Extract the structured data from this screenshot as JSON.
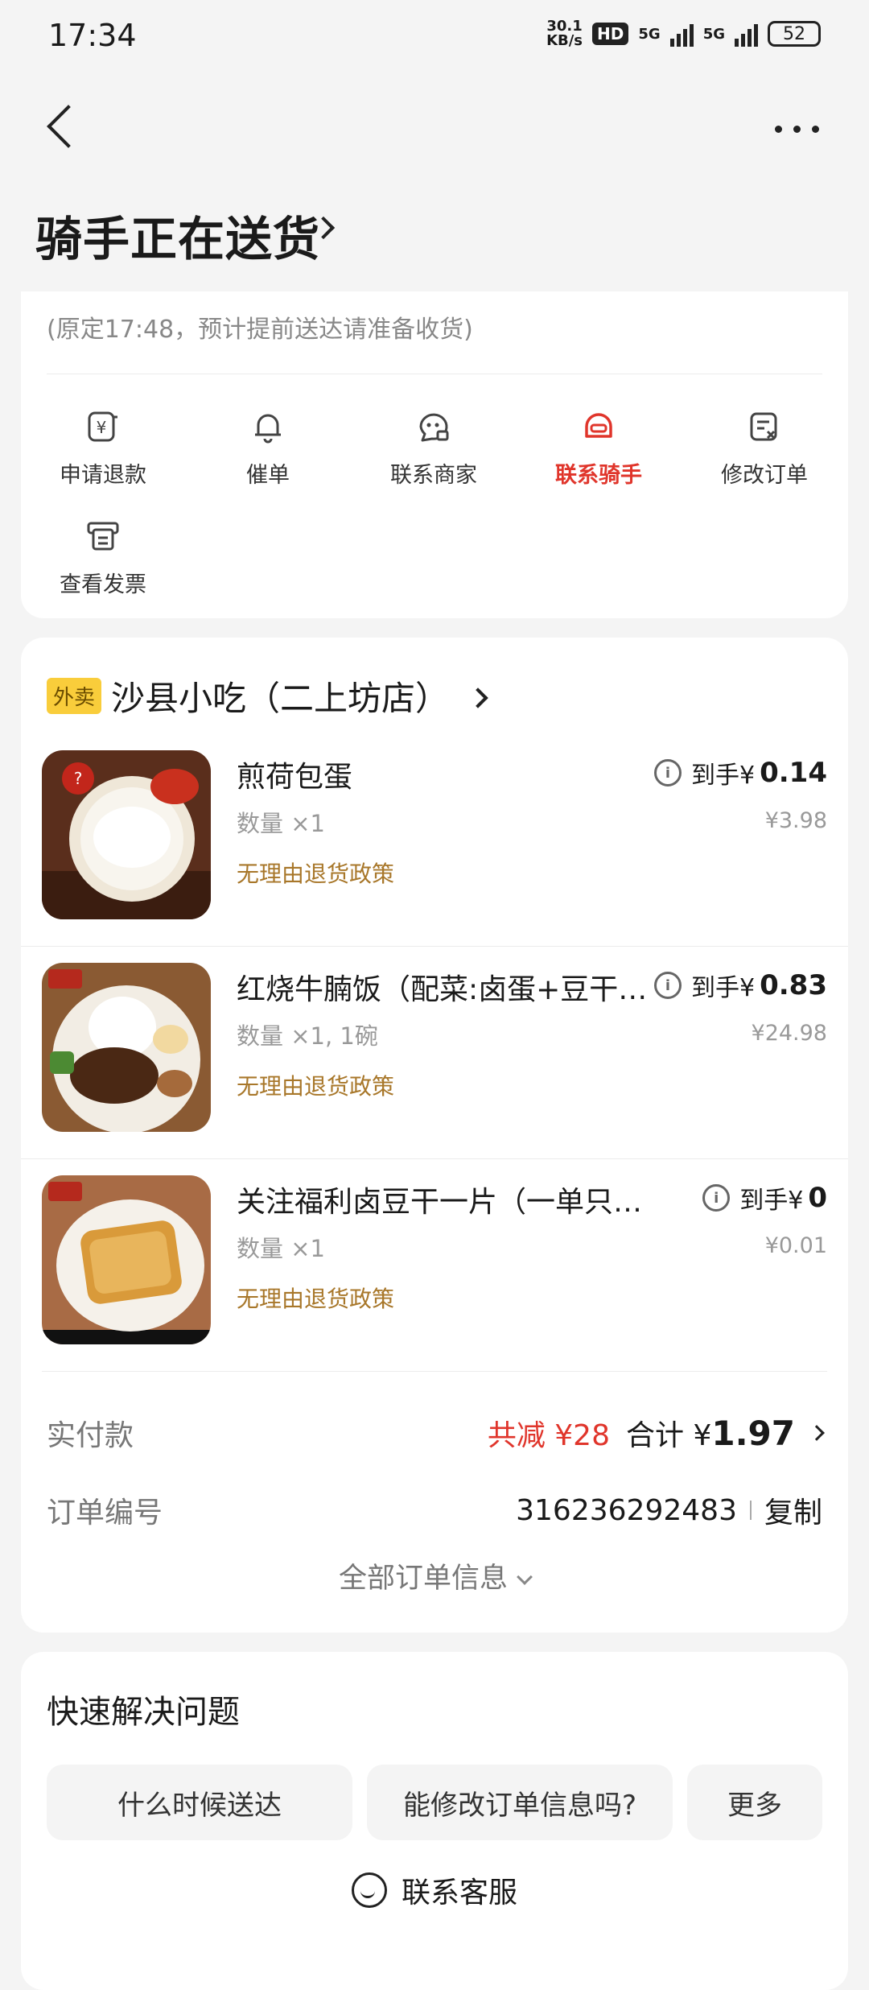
{
  "status_bar": {
    "time": "17:34",
    "net_speed_top": "30.1",
    "net_speed_bottom": "KB/s",
    "hd_badge": "HD",
    "signal_1": "5G",
    "signal_2": "5G",
    "battery": "52"
  },
  "header": {
    "title": "骑手正在送货"
  },
  "delivery": {
    "eta_text": "(原定17:48，预计提前送达请准备收货)"
  },
  "actions": [
    {
      "label": "申请退款",
      "icon": "refund-icon"
    },
    {
      "label": "催单",
      "icon": "bell-icon"
    },
    {
      "label": "联系商家",
      "icon": "merchant-chat-icon"
    },
    {
      "label": "联系骑手",
      "icon": "rider-helmet-icon",
      "active": true
    },
    {
      "label": "修改订单",
      "icon": "edit-order-icon"
    },
    {
      "label": "查看发票",
      "icon": "invoice-icon"
    }
  ],
  "store": {
    "tag": "外卖",
    "name": "沙县小吃（二上坊店）"
  },
  "items": [
    {
      "name": "煎荷包蛋",
      "qty": "数量 ×1",
      "policy": "无理由退货政策",
      "price_prefix": "到手¥",
      "price": "0.14",
      "original": "¥3.98"
    },
    {
      "name": "红烧牛腩饭（配菜:卤蛋+豆干…",
      "qty": "数量 ×1, 1碗",
      "policy": "无理由退货政策",
      "price_prefix": "到手¥",
      "price": "0.83",
      "original": "¥24.98"
    },
    {
      "name": "关注福利卤豆干一片（一单只限…",
      "qty": "数量 ×1",
      "policy": "无理由退货政策",
      "price_prefix": "到手¥",
      "price": "0",
      "original": "¥0.01"
    }
  ],
  "payment": {
    "label": "实付款",
    "discount": "共减 ¥28",
    "total_label": "合计 ¥",
    "total": "1.97"
  },
  "order": {
    "label": "订单编号",
    "number": "316236292483",
    "copy": "复制"
  },
  "all_info": "全部订单信息",
  "quick": {
    "title": "快速解决问题",
    "buttons": [
      "什么时候送达",
      "能修改订单信息吗?",
      "更多"
    ],
    "customer_service": "联系客服"
  },
  "colors": {
    "accent_red": "#e0352b",
    "policy_gold": "#a8772a",
    "tag_yellow": "#f9cd3b"
  }
}
